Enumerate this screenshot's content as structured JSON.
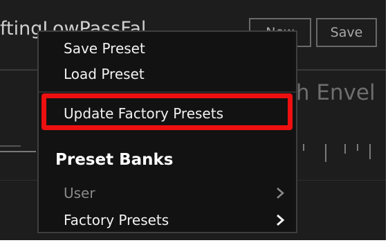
{
  "app": {
    "title_fragment": "ftingLowPassFal",
    "buttons": {
      "new_label": "New",
      "save_label": "Save"
    },
    "envelope_label": "dth Envel"
  },
  "context_menu": {
    "items": [
      {
        "label": "Save Preset"
      },
      {
        "label": "Load Preset"
      },
      {
        "label": "Update Factory Presets",
        "highlighted": true
      }
    ],
    "section_heading": "Preset Banks",
    "banks": [
      {
        "label": "User",
        "enabled": false,
        "chevron": "chevron-right-icon"
      },
      {
        "label": "Factory Presets",
        "enabled": true,
        "chevron": "chevron-right-icon"
      }
    ]
  },
  "colors": {
    "app_background": "#1d1d1d",
    "menu_background": "#121212",
    "highlight_annotation": "#ee1010",
    "disabled_text": "#8a8a8a"
  }
}
